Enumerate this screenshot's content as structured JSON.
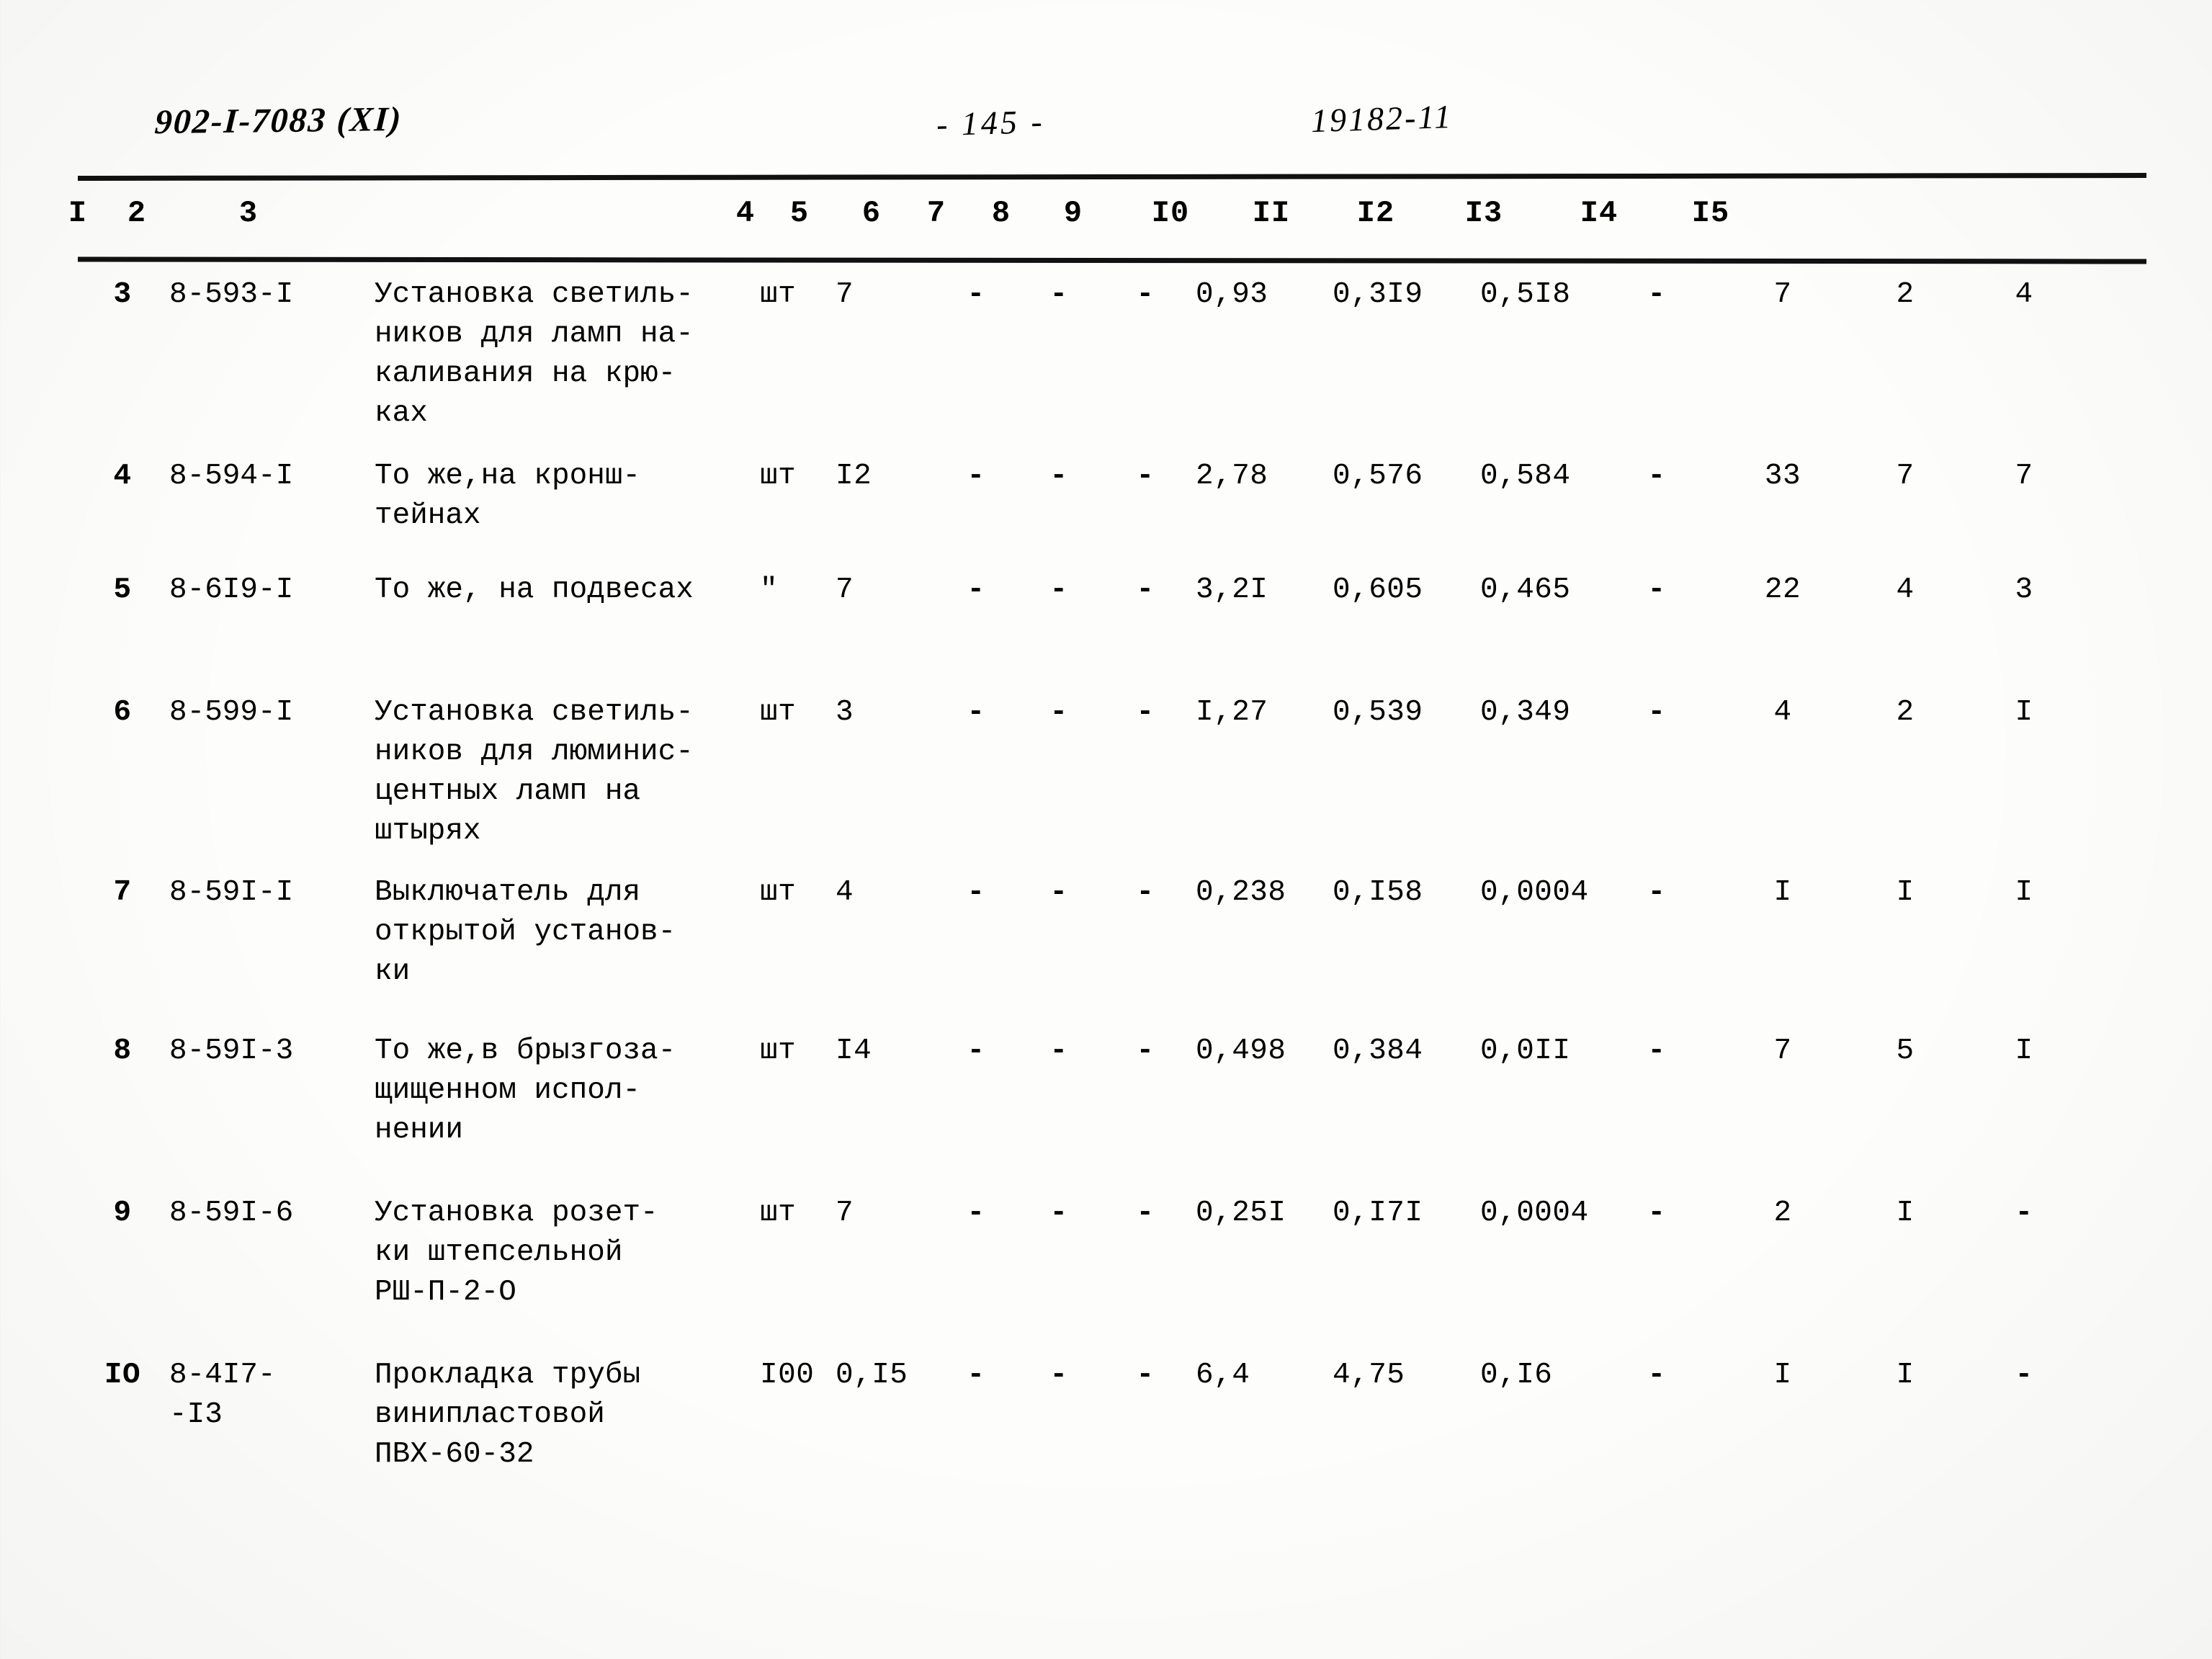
{
  "header": {
    "doc_code": "902-I-7083  (XI)",
    "page_number": "- 145 -",
    "sheet_code": "19182-11"
  },
  "table": {
    "column_headers": [
      "I",
      "2",
      "3",
      "4",
      "5",
      "6",
      "7",
      "8",
      "9",
      "I0",
      "II",
      "I2",
      "I3",
      "I4",
      "I5"
    ],
    "rows": [
      {
        "n": "3",
        "code": "8-593-I",
        "desc": "Установка светиль-\nников для ламп на-\nкаливания на крю-\nках",
        "unit": "шт",
        "qty": "7",
        "c6": "-",
        "c7": "-",
        "c8": "-",
        "c9": "0,93",
        "c10": "0,3I9",
        "c11": "0,5I8",
        "c12": "-",
        "c13": "7",
        "c14": "2",
        "c15": "4"
      },
      {
        "n": "4",
        "code": "8-594-I",
        "desc": "То же,на кронш-\nтейнах",
        "unit": "шт",
        "qty": "I2",
        "c6": "-",
        "c7": "-",
        "c8": "-",
        "c9": "2,78",
        "c10": "0,576",
        "c11": "0,584",
        "c12": "-",
        "c13": "33",
        "c14": "7",
        "c15": "7"
      },
      {
        "n": "5",
        "code": "8-6I9-I",
        "desc": "То же, на подвесах",
        "unit": "\"",
        "qty": "7",
        "c6": "-",
        "c7": "-",
        "c8": "-",
        "c9": "3,2I",
        "c10": "0,605",
        "c11": "0,465",
        "c12": "-",
        "c13": "22",
        "c14": "4",
        "c15": "3"
      },
      {
        "n": "6",
        "code": "8-599-I",
        "desc": "Установка светиль-\nников для люминис-\nцентных ламп на\nштырях",
        "unit": "шт",
        "qty": "3",
        "c6": "-",
        "c7": "-",
        "c8": "-",
        "c9": "I,27",
        "c10": "0,539",
        "c11": "0,349",
        "c12": "-",
        "c13": "4",
        "c14": "2",
        "c15": "I"
      },
      {
        "n": "7",
        "code": "8-59I-I",
        "desc": "Выключатель для\nоткрытой установ-\nки",
        "unit": "шт",
        "qty": "4",
        "c6": "-",
        "c7": "-",
        "c8": "-",
        "c9": "0,238",
        "c10": "0,I58",
        "c11": "0,0004",
        "c12": "-",
        "c13": "I",
        "c14": "I",
        "c15": "I"
      },
      {
        "n": "8",
        "code": "8-59I-3",
        "desc": "То же,в брызгоза-\nщищенном испол-\nнении",
        "unit": "шт",
        "qty": "I4",
        "c6": "-",
        "c7": "-",
        "c8": "-",
        "c9": "0,498",
        "c10": "0,384",
        "c11": "0,0II",
        "c12": "-",
        "c13": "7",
        "c14": "5",
        "c15": "I"
      },
      {
        "n": "9",
        "code": "8-59I-6",
        "desc": "Установка розет-\nки штепсельной\nРШ-П-2-О",
        "unit": "шт",
        "qty": "7",
        "c6": "-",
        "c7": "-",
        "c8": "-",
        "c9": "0,25I",
        "c10": "0,I7I",
        "c11": "0,0004",
        "c12": "-",
        "c13": "2",
        "c14": "I",
        "c15": "-"
      },
      {
        "n": "IO",
        "code": "8-4I7-\n-I3",
        "desc": "Прокладка трубы\nвинипластовой\nПВХ-60-32",
        "unit": "I00",
        "qty": "0,I5",
        "c6": "-",
        "c7": "-",
        "c8": "-",
        "c9": "6,4",
        "c10": "4,75",
        "c11": "0,I6",
        "c12": "-",
        "c13": "I",
        "c14": "I",
        "c15": "-"
      }
    ]
  }
}
